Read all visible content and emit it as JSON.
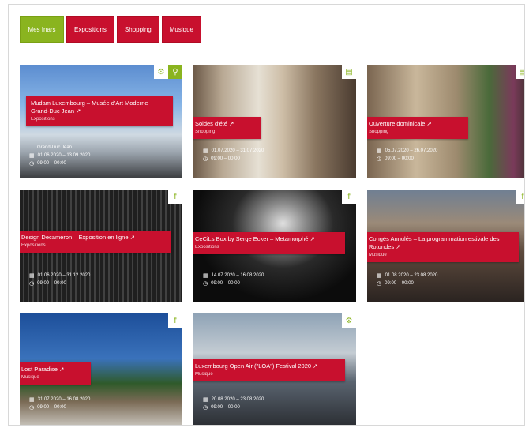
{
  "filters": [
    {
      "label": "Mes Inars",
      "active": true
    },
    {
      "label": "Expositions",
      "active": false
    },
    {
      "label": "Shopping",
      "active": false
    },
    {
      "label": "Musique",
      "active": false
    }
  ],
  "events": [
    {
      "title": "Mudam Luxembourg – Musée d'Art Moderne Grand-Duc Jean ↗",
      "category": "Expositions",
      "extra": "Grand-Duc Jean",
      "dates": "01.06.2020 – 13.09.2020",
      "hours": "09:00 – 00:00",
      "icons": [
        "gear-icon",
        "pin-icon"
      ]
    },
    {
      "title": "Soldes d'été ↗",
      "category": "Shopping",
      "dates": "01.07.2020 – 31.07.2020",
      "hours": "09:00 – 00:00",
      "icons": [
        "store-icon"
      ]
    },
    {
      "title": "Ouverture dominicale ↗",
      "category": "Shopping",
      "dates": "05.07.2020 – 26.07.2020",
      "hours": "09:00 – 00:00",
      "icons": [
        "store-icon"
      ]
    },
    {
      "title": "Design Decameron – Exposition en ligne ↗",
      "category": "Expositions",
      "dates": "01.06.2020 – 31.12.2020",
      "hours": "09:00 – 00:00",
      "icons": [
        "facebook-icon"
      ]
    },
    {
      "title": "CeCiLs Box by Serge Ecker – Metamorphé ↗",
      "category": "Expositions",
      "dates": "14.07.2020 – 16.08.2020",
      "hours": "09:00 – 00:00",
      "icons": [
        "facebook-icon"
      ]
    },
    {
      "title": "Congés Annulés – La programmation estivale des Rotondes ↗",
      "category": "Musique",
      "dates": "01.08.2020 – 23.08.2020",
      "hours": "09:00 – 00:00",
      "icons": [
        "facebook-icon"
      ]
    },
    {
      "title": "Lost Paradise ↗",
      "category": "Musique",
      "dates": "31.07.2020 – 16.08.2020",
      "hours": "09:00 – 00:00",
      "icons": [
        "facebook-icon"
      ]
    },
    {
      "title": "Luxembourg Open Air (\"LOA\") Festival 2020 ↗",
      "category": "Musique",
      "dates": "20.08.2020 – 23.08.2020",
      "hours": "09:00 – 00:00",
      "icons": [
        "gear-icon"
      ]
    }
  ],
  "icons_glyphs": {
    "gear-icon": "⚙",
    "pin-icon": "⚲",
    "store-icon": "▤",
    "facebook-icon": "f"
  },
  "meta_icons": {
    "calendar": "▦",
    "clock": "◷"
  },
  "colors": {
    "red": "#c8102e",
    "green": "#8ab41f"
  }
}
